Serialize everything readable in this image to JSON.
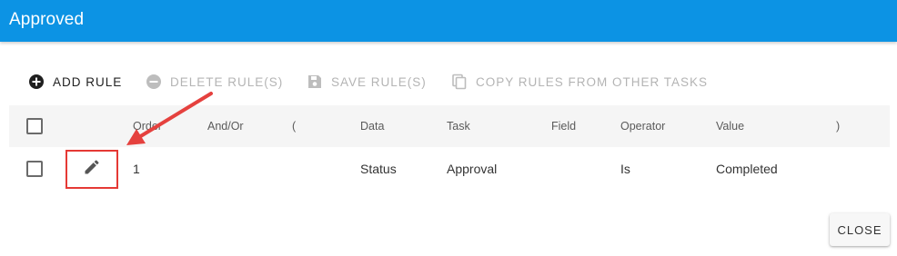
{
  "dialog": {
    "title": "Approved"
  },
  "toolbar": {
    "add_rule": {
      "label": "ADD RULE",
      "icon": "plus-circle-icon",
      "enabled": true
    },
    "delete_rules": {
      "label": "DELETE RULE(S)",
      "icon": "minus-circle-icon",
      "enabled": false
    },
    "save_rules": {
      "label": "SAVE RULE(S)",
      "icon": "save-icon",
      "enabled": false
    },
    "copy_rules": {
      "label": "COPY RULES FROM OTHER TASKS",
      "icon": "copy-icon",
      "enabled": false
    }
  },
  "table": {
    "headers": {
      "order": "Order",
      "and_or": "And/Or",
      "open_paren": "(",
      "data": "Data",
      "task": "Task",
      "field": "Field",
      "operator": "Operator",
      "value": "Value",
      "close_paren": ")"
    },
    "rows": [
      {
        "order": "1",
        "and_or": "",
        "open_paren": "",
        "data": "Status",
        "task": "Approval",
        "field": "",
        "operator": "Is",
        "value": "Completed",
        "close_paren": "",
        "edit_icon": "pencil-icon"
      }
    ]
  },
  "annotation": {
    "highlight_color": "#e53935",
    "arrow_color": "#e5413e"
  },
  "footer": {
    "close_label": "CLOSE"
  },
  "colors": {
    "header_bar": "#0c93e4",
    "header_row_bg": "#f5f5f5",
    "disabled_text": "#b4b4b4"
  }
}
